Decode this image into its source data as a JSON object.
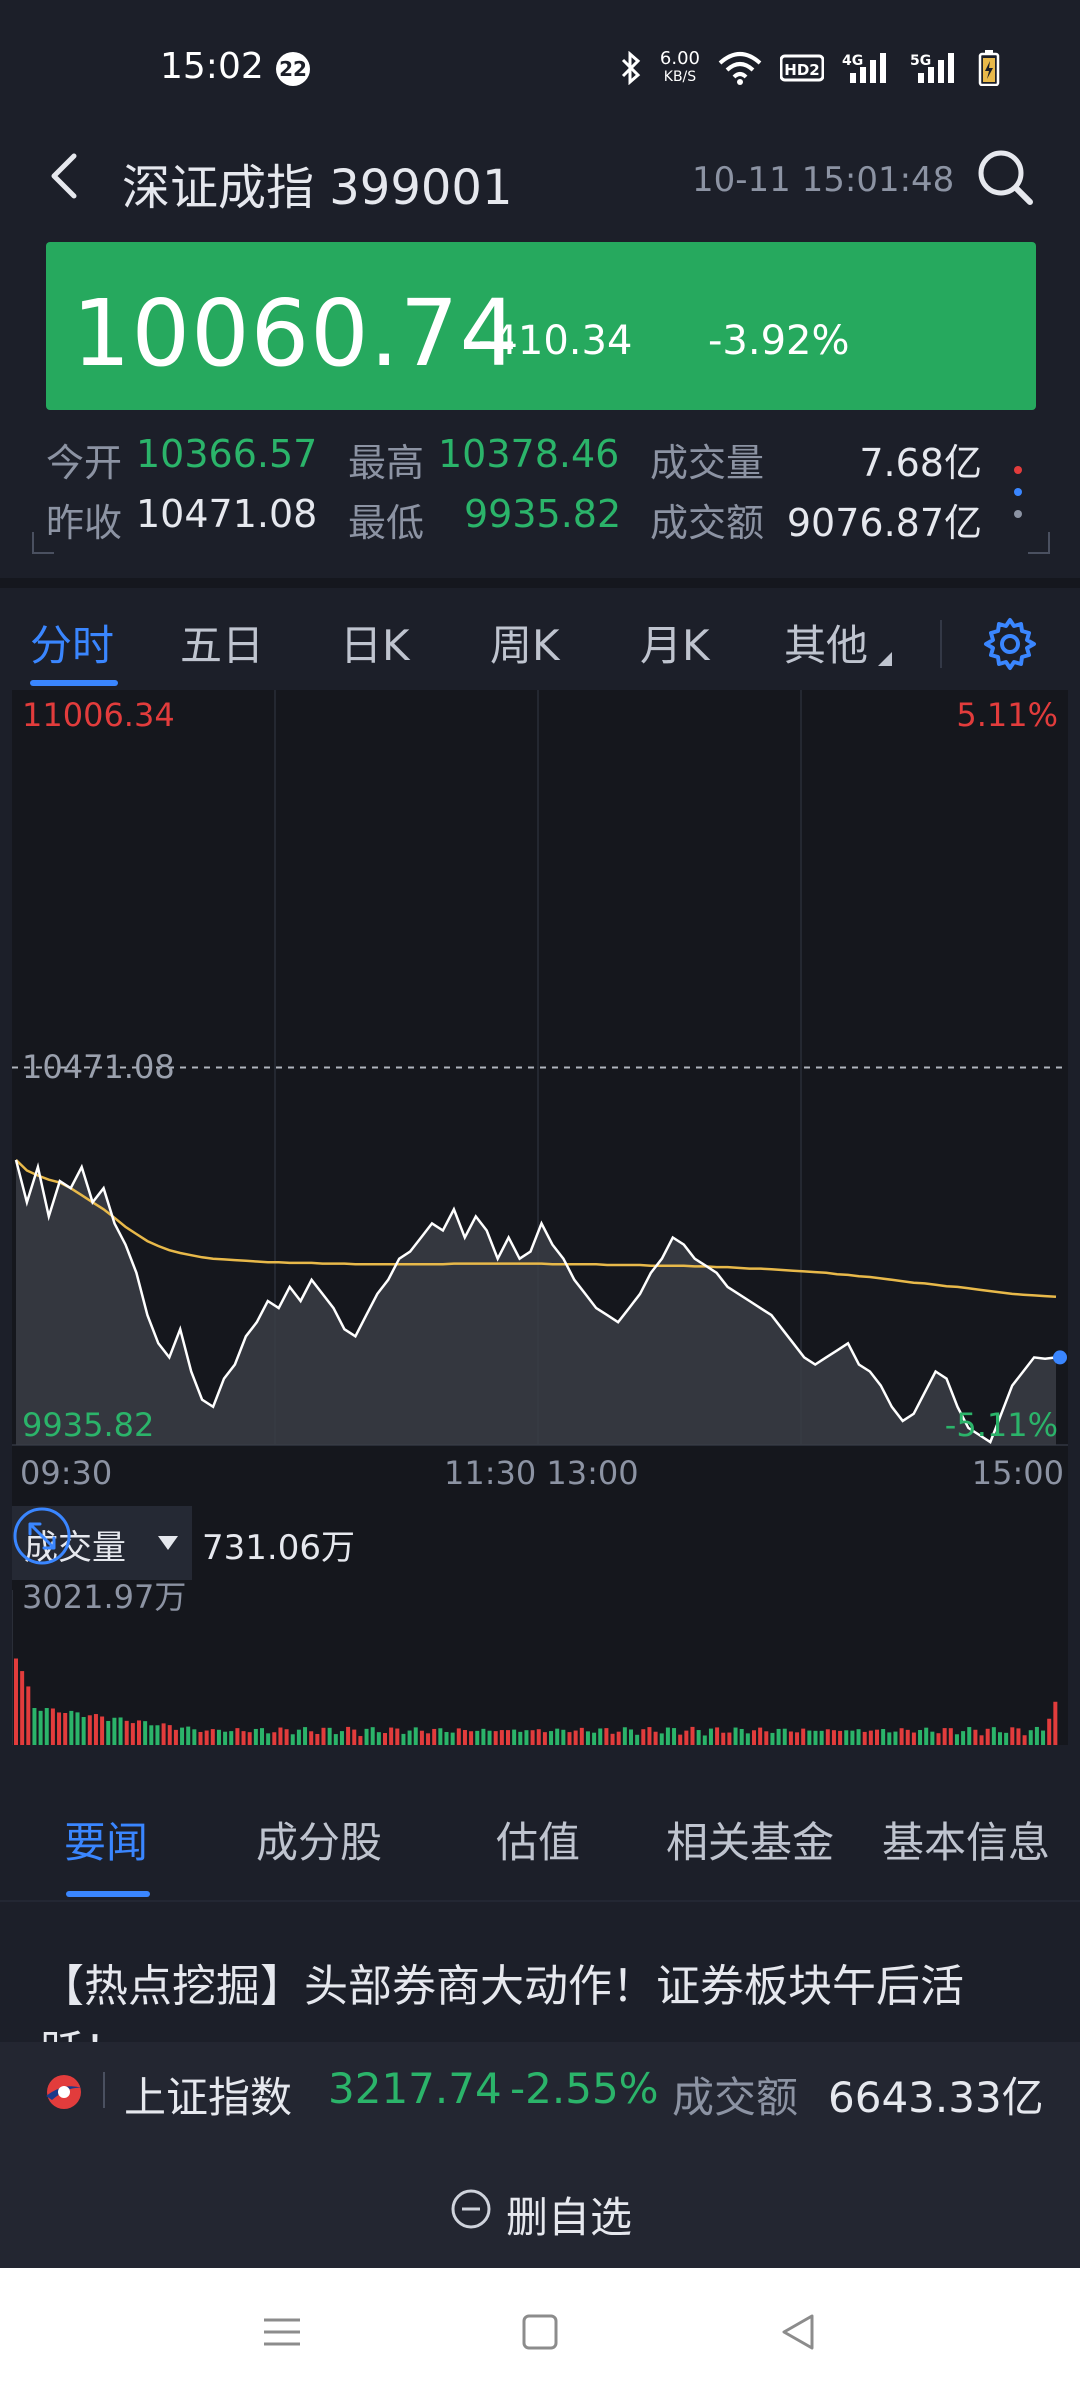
{
  "status_bar": {
    "time": "15:02",
    "notif_count": "22",
    "net_speed_value": "6.00",
    "net_speed_unit": "KB/S",
    "hd": "HD2",
    "sig1": "4G",
    "sig2": "5G"
  },
  "header": {
    "title": "深证成指 399001",
    "updated": "10-11 15:01:48"
  },
  "quote": {
    "price": "10060.74",
    "change": "-410.34",
    "change_pct": "-3.92%"
  },
  "stats": {
    "open_label": "今开",
    "open": "10366.57",
    "high_label": "最高",
    "high": "10378.46",
    "volume_label": "成交量",
    "volume": "7.68亿",
    "prev_close_label": "昨收",
    "prev_close": "10471.08",
    "low_label": "最低",
    "low": "9935.82",
    "amount_label": "成交额",
    "amount": "9076.87亿"
  },
  "chart_tabs": [
    {
      "label": "分时"
    },
    {
      "label": "五日"
    },
    {
      "label": "日K"
    },
    {
      "label": "周K"
    },
    {
      "label": "月K"
    },
    {
      "label": "其他"
    }
  ],
  "chart": {
    "top_price": "11006.34",
    "top_pct": "5.11%",
    "mid_price": "10471.08",
    "bottom_price": "9935.82",
    "bottom_pct": "-5.11%",
    "time_labels": [
      "09:30",
      "11:30 13:00",
      "15:00"
    ],
    "volume_selector": "成交量",
    "volume_value": "731.06万",
    "volume_max": "3021.97万"
  },
  "chart_data": {
    "type": "line",
    "series": [
      {
        "values": [
          10340,
          10280,
          10330,
          10260,
          10310,
          10300,
          10330,
          10280,
          10300,
          10250,
          10220,
          10180,
          10120,
          10080,
          10060,
          10100,
          10040,
          10000,
          9990,
          10030,
          10050,
          10090,
          10110,
          10140,
          10130,
          10160,
          10140,
          10170,
          10150,
          10130,
          10100,
          10090,
          10120,
          10150,
          10170,
          10200,
          10210,
          10230,
          10250,
          10240,
          10270,
          10230,
          10260,
          10240,
          10200,
          10230,
          10200,
          10210,
          10250,
          10220,
          10200,
          10170,
          10150,
          10130,
          10120,
          10110,
          10130,
          10150,
          10180,
          10200,
          10230,
          10220,
          10200,
          10190,
          10180,
          10160,
          10150,
          10140,
          10130,
          10120,
          10100,
          10080,
          10060,
          10050,
          10060,
          10070,
          10080,
          10050,
          10040,
          10020,
          9990,
          9970,
          9980,
          10010,
          10040,
          10030,
          9990,
          9960,
          9950,
          9940,
          9980,
          10020,
          10040,
          10060,
          10058,
          10060
        ]
      },
      {
        "values": [
          10340,
          10325,
          10318,
          10312,
          10308,
          10300,
          10290,
          10280,
          10270,
          10258,
          10245,
          10235,
          10225,
          10218,
          10212,
          10208,
          10205,
          10202,
          10200,
          10199,
          10198,
          10197,
          10196,
          10195,
          10195,
          10194,
          10194,
          10194,
          10193,
          10193,
          10193,
          10192,
          10192,
          10192,
          10192,
          10192,
          10192,
          10192,
          10192,
          10192,
          10193,
          10193,
          10193,
          10193,
          10193,
          10193,
          10193,
          10193,
          10193,
          10192,
          10192,
          10192,
          10192,
          10192,
          10191,
          10191,
          10191,
          10191,
          10190,
          10190,
          10190,
          10190,
          10189,
          10189,
          10188,
          10188,
          10187,
          10186,
          10186,
          10185,
          10184,
          10183,
          10182,
          10181,
          10180,
          10178,
          10177,
          10175,
          10174,
          10172,
          10170,
          10168,
          10166,
          10165,
          10163,
          10161,
          10160,
          10158,
          10156,
          10154,
          10152,
          10150,
          10149,
          10148,
          10147,
          10146
        ]
      }
    ],
    "ylim": [
      9935.82,
      11006.34
    ],
    "y_ticks": [
      11006.34,
      10471.08,
      9935.82
    ]
  },
  "info_tabs": [
    {
      "label": "要闻"
    },
    {
      "label": "成分股"
    },
    {
      "label": "估值"
    },
    {
      "label": "相关基金"
    },
    {
      "label": "基本信息"
    }
  ],
  "news": {
    "headline": "【热点挖掘】头部券商大动作！证券板块午后活跃！"
  },
  "ticker": {
    "name": "上证指数",
    "price": "3217.74",
    "change_pct": "-2.55%",
    "amount_label": "成交额",
    "amount": "6643.33亿"
  },
  "actions": {
    "remove_watchlist": "删自选"
  },
  "colors": {
    "up": "#e23c3c",
    "down": "#2bb46a",
    "accent": "#3a86ff",
    "avg_line": "#e8b94a",
    "banner": "#26a95e"
  }
}
